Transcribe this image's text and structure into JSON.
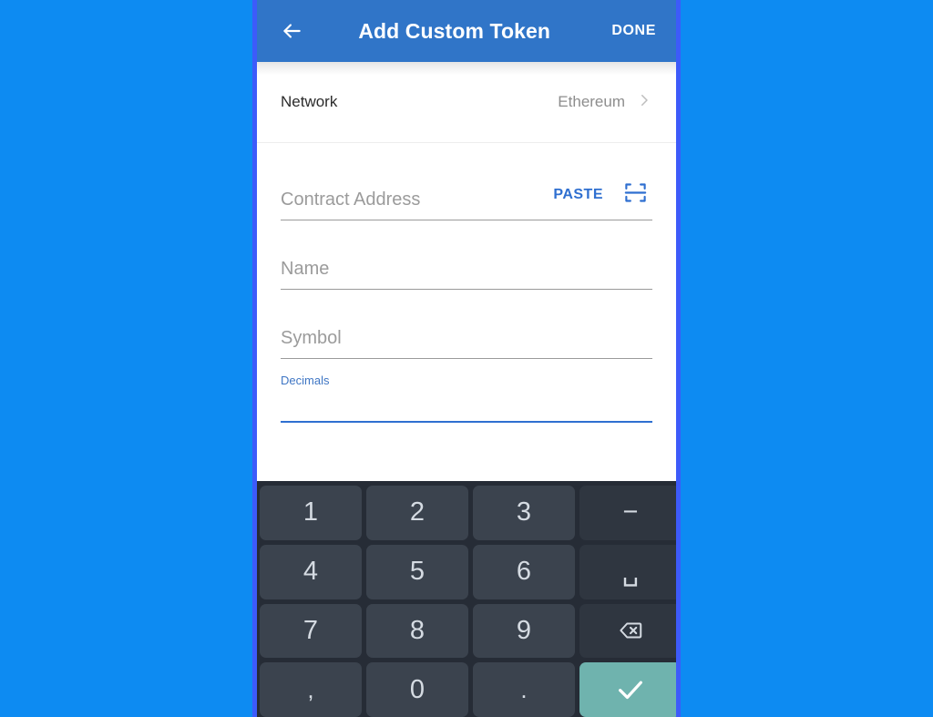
{
  "appbar": {
    "back_icon": "arrow-left-icon",
    "title": "Add Custom Token",
    "done_label": "DONE"
  },
  "network": {
    "label": "Network",
    "value": "Ethereum",
    "chevron_icon": "chevron-right-icon"
  },
  "form": {
    "contract_address": {
      "placeholder": "Contract Address",
      "value": "",
      "paste_label": "PASTE",
      "scan_icon": "qr-scan-icon"
    },
    "name": {
      "placeholder": "Name",
      "value": ""
    },
    "symbol": {
      "placeholder": "Symbol",
      "value": ""
    },
    "decimals": {
      "label": "Decimals",
      "value": "",
      "focused": true
    }
  },
  "keyboard": {
    "rows": [
      [
        {
          "key": "1",
          "type": "num"
        },
        {
          "key": "2",
          "type": "num"
        },
        {
          "key": "3",
          "type": "num"
        },
        {
          "key": "−",
          "type": "fn",
          "name": "minus-key"
        }
      ],
      [
        {
          "key": "4",
          "type": "num"
        },
        {
          "key": "5",
          "type": "num"
        },
        {
          "key": "6",
          "type": "num"
        },
        {
          "key": "␣",
          "type": "fn",
          "name": "space-key"
        }
      ],
      [
        {
          "key": "7",
          "type": "num"
        },
        {
          "key": "8",
          "type": "num"
        },
        {
          "key": "9",
          "type": "num"
        },
        {
          "key": "backspace-icon",
          "type": "fn",
          "name": "backspace-key"
        }
      ],
      [
        {
          "key": ",",
          "type": "num"
        },
        {
          "key": "0",
          "type": "num"
        },
        {
          "key": ".",
          "type": "num"
        },
        {
          "key": "check-icon",
          "type": "enter",
          "name": "enter-key"
        }
      ]
    ]
  },
  "colors": {
    "background": "#0d8bf2",
    "frame_border": "#3d5bfa",
    "appbar": "#3075c8",
    "accent_blue": "#2f6fd0",
    "keyboard_bg": "#262c36",
    "key_bg": "#3b434e",
    "key_fn_bg": "#2f3640",
    "enter_key": "#6fb3ae"
  }
}
